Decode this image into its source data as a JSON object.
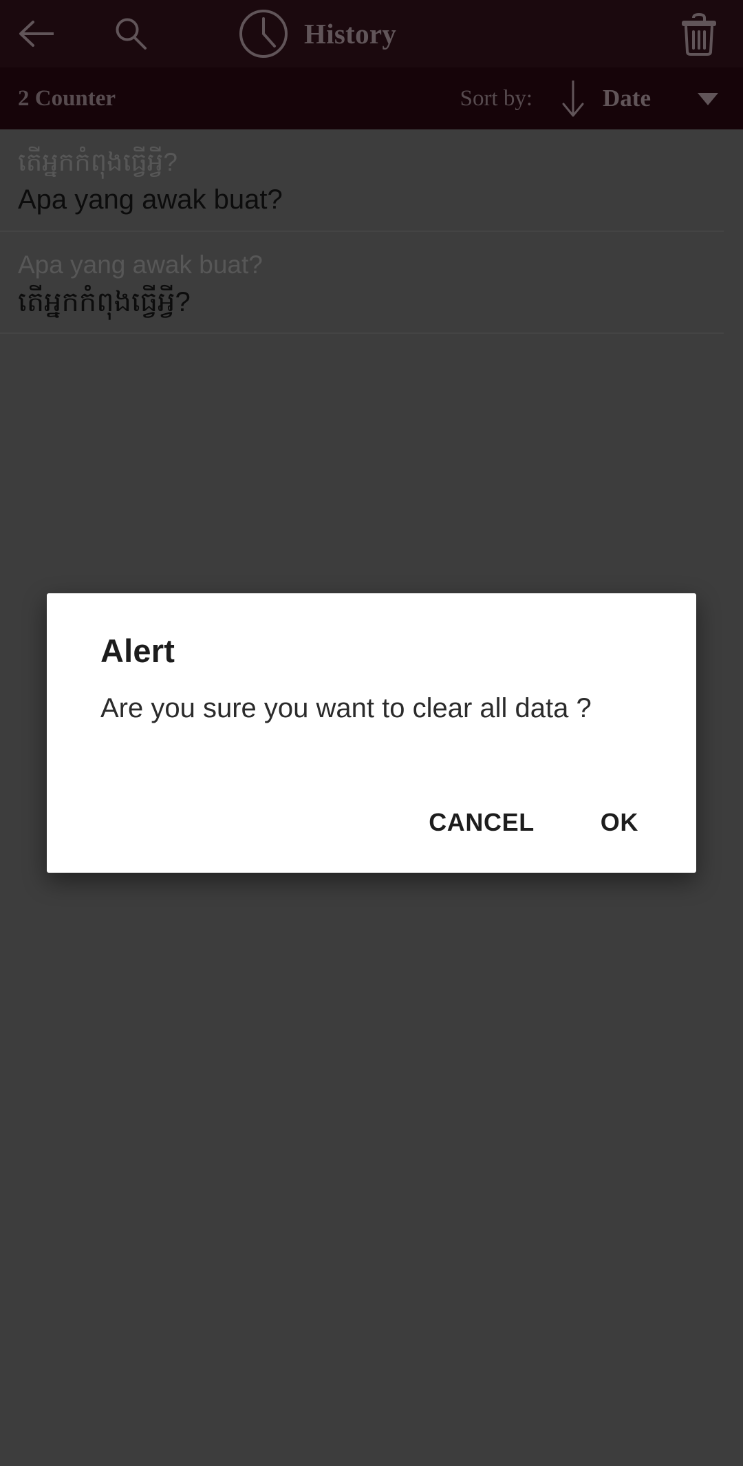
{
  "appbar": {
    "back_icon": "arrow-left-icon",
    "search_icon": "search-icon",
    "clock_icon": "clock-icon",
    "title": "History",
    "delete_icon": "trash-icon"
  },
  "sortbar": {
    "counter_label": "2 Counter",
    "sort_by_label": "Sort by:",
    "sort_direction_icon": "arrow-down-icon",
    "sort_field": "Date",
    "dropdown_icon": "caret-down-icon"
  },
  "history": {
    "rows": [
      {
        "source": "តើអ្នកកំពុងធ្វើអ្វី?",
        "target": "Apa yang awak buat?"
      },
      {
        "source": "Apa yang awak buat?",
        "target": "តើអ្នកកំពុងធ្វើអ្វី?"
      }
    ]
  },
  "dialog": {
    "title": "Alert",
    "message": "Are you sure you want to clear all data ?",
    "cancel_label": "CANCEL",
    "ok_label": "OK"
  },
  "colors": {
    "appbar_bg": "#2d0f18",
    "sortbar_bg": "#250810",
    "appbar_text": "#9d8a90",
    "scrim": "#636363",
    "dialog_bg": "#ffffff",
    "list_text": "#141414",
    "list_muted": "#8d8d8d"
  }
}
